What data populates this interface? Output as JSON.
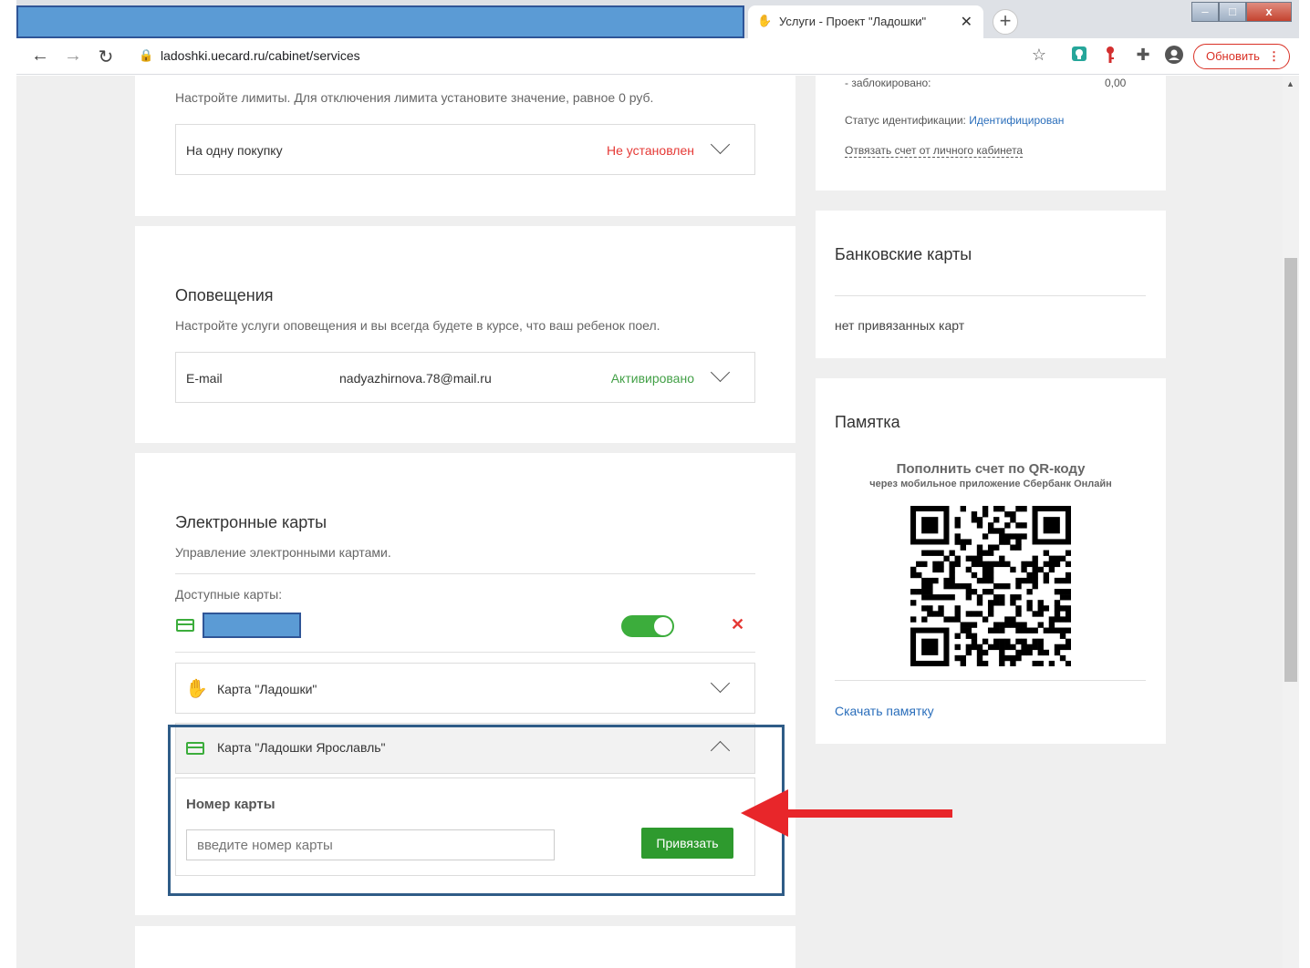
{
  "browser": {
    "tab_title": "Услуги - Проект \"Ладошки\"",
    "tab_favicon": "hand-icon",
    "close_tab": "✕",
    "new_tab": "+",
    "url": "ladoshki.uecard.ru/cabinet/services",
    "update_label": "Обновить",
    "window_controls": [
      "–",
      "□",
      "x"
    ]
  },
  "limits": {
    "description": "Настройте лимиты. Для отключения лимита установите значение, равное 0 руб.",
    "row_label": "На одну покупку",
    "row_status": "Не установлен",
    "status_color": "#e53935"
  },
  "notifications": {
    "title": "Оповещения",
    "description": "Настройте услуги оповещения и вы всегда будете в курсе, что ваш ребенок поел.",
    "row_label": "E-mail",
    "row_email": "nadyazhirnova.78@mail.ru",
    "row_status": "Активировано",
    "status_color": "#43a047"
  },
  "ecards": {
    "title": "Электронные карты",
    "description": "Управление электронными картами.",
    "available_label": "Доступные карты:",
    "toggle_on": true,
    "delete_icon": "✕",
    "cards": [
      {
        "label": "Карта \"Ладошки\"",
        "icon": "hand-icon",
        "expanded": false
      },
      {
        "label": "Карта \"Ладошки Ярославль\"",
        "icon": "card-icon",
        "expanded": true
      }
    ],
    "card_number_label": "Номер карты",
    "card_number_placeholder": "введите номер карты",
    "bind_button": "Привязать"
  },
  "account": {
    "blocked_label": "- заблокировано:",
    "blocked_value": "0,00",
    "ident_label": "Статус идентификации:",
    "ident_value": "Идентифицирован",
    "unlink_link": "Отвязать счет от личного кабинета"
  },
  "bank_cards": {
    "title": "Банковские карты",
    "empty_text": "нет привязанных карт"
  },
  "memo": {
    "title": "Памятка",
    "qr_title": "Пополнить счет по QR-коду",
    "qr_subtitle": "через мобильное приложение Сбербанк Онлайн",
    "download_link": "Скачать памятку"
  },
  "colors": {
    "accent_blue": "#2a6ebb",
    "green": "#2e9a2e",
    "annotation_red": "#e8262a",
    "highlight_border": "#2f5c87"
  }
}
